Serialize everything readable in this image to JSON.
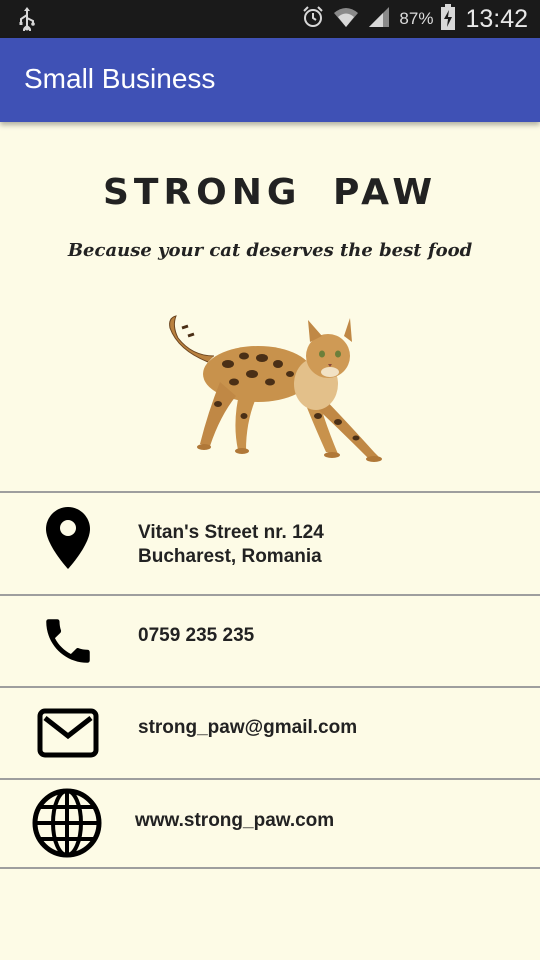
{
  "status_bar": {
    "battery_percent": "87%",
    "time": "13:42",
    "icons": [
      "usb-icon",
      "alarm-icon",
      "wifi-icon",
      "signal-icon",
      "battery-charging-icon"
    ]
  },
  "app_bar": {
    "title": "Small Business",
    "color": "#3f51b5"
  },
  "header": {
    "brand": "STRONG PAW",
    "slogan": "Because your cat deserves the best food",
    "image": "bengal-cat-image"
  },
  "contacts": [
    {
      "icon": "location-pin-icon",
      "line1": "Vitan's Street nr. 124",
      "line2": "Bucharest, Romania"
    },
    {
      "icon": "phone-icon",
      "line1": "0759 235 235"
    },
    {
      "icon": "mail-icon",
      "line1": "strong_paw@gmail.com"
    },
    {
      "icon": "globe-icon",
      "line1": "www.strong_paw.com"
    }
  ],
  "colors": {
    "background": "#fdfbe6",
    "text": "#222222"
  }
}
